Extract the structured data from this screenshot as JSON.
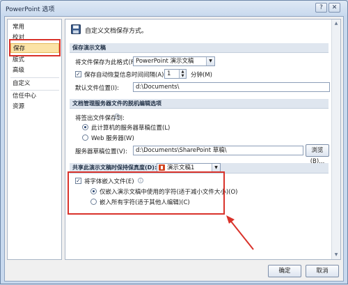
{
  "window": {
    "title": "PowerPoint 选项",
    "help_glyph": "?",
    "close_glyph": "✕"
  },
  "nav": {
    "items": [
      {
        "label": "常用",
        "selected": false
      },
      {
        "label": "校对",
        "selected": false
      },
      {
        "label": "保存",
        "selected": true
      },
      {
        "label": "版式",
        "selected": false
      },
      {
        "label": "高级",
        "selected": false
      },
      {
        "label": "自定义",
        "selected": false
      },
      {
        "label": "信任中心",
        "selected": false
      },
      {
        "label": "资源",
        "selected": false
      }
    ]
  },
  "header": {
    "title": "自定义文档保存方式。"
  },
  "save_presentations": {
    "section_title": "保存演示文稿",
    "format_label": "将文件保存为此格式(F):",
    "format_value": "PowerPoint 演示文稿",
    "autorecover_label": "保存自动恢复信息时间间隔(A)",
    "autorecover_checked": true,
    "autorecover_value": "1",
    "autorecover_unit": "分钟(M)",
    "default_location_label": "默认文件位置(I):",
    "default_location_value": "d:\\Documents\\"
  },
  "offline_editing": {
    "section_title": "文档管理服务器文件的脱机编辑选项",
    "checkout_label": "将签出文件保存到:",
    "option_local_label": "此计算机的服务器草稿位置(L)",
    "option_local_selected": true,
    "option_web_label": "Web 服务器(W)",
    "option_web_selected": false,
    "drafts_label": "服务器草稿位置(V):",
    "drafts_value": "d:\\Documents\\SharePoint 草稿\\",
    "browse_label": "浏览(B)..."
  },
  "fidelity": {
    "section_title": "共享此演示文稿时保持保真度(D):",
    "doc_value": "演示文稿1",
    "embed_fonts_label": "将字体嵌入文件(E)",
    "embed_fonts_checked": true,
    "embed_used_label": "仅嵌入演示文稿中使用的字符(适于减小文件大小)(O)",
    "embed_used_selected": true,
    "embed_all_label": "嵌入所有字符(适于其他人编辑)(C)",
    "embed_all_selected": false
  },
  "footer": {
    "ok_label": "确定",
    "cancel_label": "取消"
  },
  "colors": {
    "highlight_red": "#d9322a",
    "selected_nav_bg": "#fbe3a6"
  }
}
